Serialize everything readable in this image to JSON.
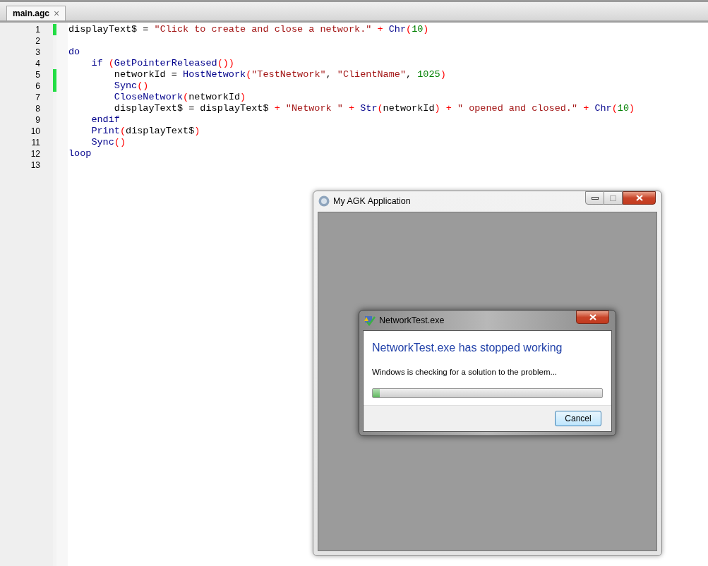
{
  "tabs": [
    {
      "label": "main.agc",
      "close": "×",
      "selected": true
    }
  ],
  "editor": {
    "lines": [
      {
        "number": "1",
        "modified": true,
        "tokens": [
          {
            "kind": "plain",
            "text": "displayText$ = "
          },
          {
            "kind": "str",
            "text": "\"Click to create and close a network.\""
          },
          {
            "kind": "op",
            "text": " + "
          },
          {
            "kind": "fn",
            "text": "Chr"
          },
          {
            "kind": "op",
            "text": "("
          },
          {
            "kind": "num",
            "text": "10"
          },
          {
            "kind": "op",
            "text": ")"
          }
        ]
      },
      {
        "number": "2",
        "modified": false
      },
      {
        "number": "3",
        "modified": false,
        "tokens": [
          {
            "kind": "kw",
            "text": "do"
          }
        ]
      },
      {
        "number": "4",
        "modified": false,
        "tokens": [
          {
            "kind": "kw",
            "text": "    if"
          },
          {
            "kind": "op",
            "text": " ("
          },
          {
            "kind": "fn",
            "text": "GetPointerReleased"
          },
          {
            "kind": "op",
            "text": "())"
          }
        ]
      },
      {
        "number": "5",
        "modified": true,
        "tokens": [
          {
            "kind": "plain",
            "text": "        networkId = "
          },
          {
            "kind": "fn",
            "text": "HostNetwork"
          },
          {
            "kind": "op",
            "text": "("
          },
          {
            "kind": "str",
            "text": "\"TestNetwork\""
          },
          {
            "kind": "plain",
            "text": ", "
          },
          {
            "kind": "str",
            "text": "\"ClientName\""
          },
          {
            "kind": "plain",
            "text": ", "
          },
          {
            "kind": "num",
            "text": "1025"
          },
          {
            "kind": "op",
            "text": ")"
          }
        ]
      },
      {
        "number": "6",
        "modified": true,
        "tokens": [
          {
            "kind": "fn",
            "text": "        Sync"
          },
          {
            "kind": "op",
            "text": "()"
          }
        ]
      },
      {
        "number": "7",
        "modified": false,
        "tokens": [
          {
            "kind": "fn",
            "text": "        CloseNetwork"
          },
          {
            "kind": "op",
            "text": "("
          },
          {
            "kind": "plain",
            "text": "networkId"
          },
          {
            "kind": "op",
            "text": ")"
          }
        ]
      },
      {
        "number": "8",
        "modified": false,
        "tokens": [
          {
            "kind": "plain",
            "text": "        displayText$ = displayText$ "
          },
          {
            "kind": "op",
            "text": "+ "
          },
          {
            "kind": "str",
            "text": "\"Network \""
          },
          {
            "kind": "op",
            "text": " + "
          },
          {
            "kind": "fn",
            "text": "Str"
          },
          {
            "kind": "op",
            "text": "("
          },
          {
            "kind": "plain",
            "text": "networkId"
          },
          {
            "kind": "op",
            "text": ") + "
          },
          {
            "kind": "str",
            "text": "\" opened and closed.\""
          },
          {
            "kind": "op",
            "text": " + "
          },
          {
            "kind": "fn",
            "text": "Chr"
          },
          {
            "kind": "op",
            "text": "("
          },
          {
            "kind": "num",
            "text": "10"
          },
          {
            "kind": "op",
            "text": ")"
          }
        ]
      },
      {
        "number": "9",
        "modified": false,
        "tokens": [
          {
            "kind": "kw",
            "text": "    endif"
          }
        ]
      },
      {
        "number": "10",
        "modified": false,
        "tokens": [
          {
            "kind": "fn",
            "text": "    Print"
          },
          {
            "kind": "op",
            "text": "("
          },
          {
            "kind": "plain",
            "text": "displayText$"
          },
          {
            "kind": "op",
            "text": ")"
          }
        ]
      },
      {
        "number": "11",
        "modified": false,
        "tokens": [
          {
            "kind": "fn",
            "text": "    Sync"
          },
          {
            "kind": "op",
            "text": "()"
          }
        ]
      },
      {
        "number": "12",
        "modified": false,
        "tokens": [
          {
            "kind": "kw",
            "text": "loop"
          }
        ]
      },
      {
        "number": "13",
        "modified": false
      }
    ]
  },
  "app_window": {
    "title": "My AGK Application"
  },
  "error_dialog": {
    "title": "NetworkTest.exe",
    "heading": "NetworkTest.exe has stopped working",
    "message": "Windows is checking for a solution to the problem...",
    "progress": {
      "level": 0.03
    },
    "buttons": [
      "Cancel"
    ]
  }
}
